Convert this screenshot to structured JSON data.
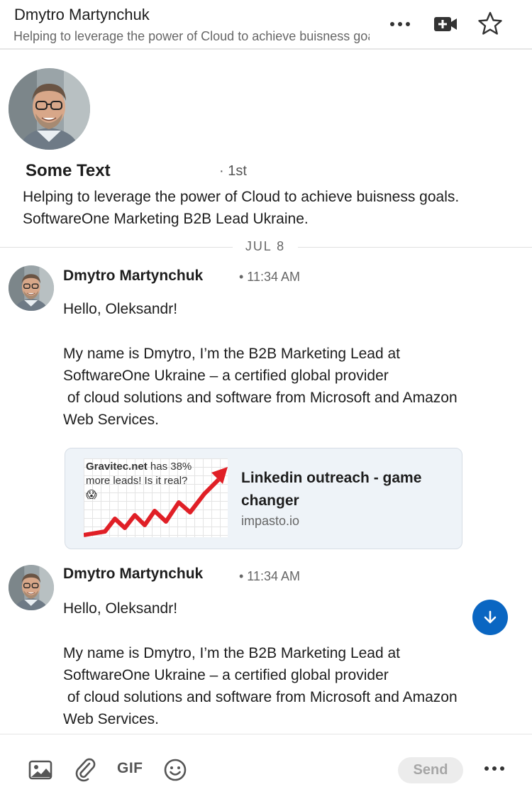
{
  "header": {
    "name": "Dmytro Martynchuk",
    "headline": "Helping to leverage the power of Cloud to achieve buisness goals. SoftwareOne Marketing B2B Lead Ukraine."
  },
  "profile": {
    "name": "Some Text",
    "degree": "· 1st",
    "headline": "Helping to leverage the power of Cloud to achieve buisness goals. SoftwareOne Marketing B2B Lead Ukraine."
  },
  "conversation": {
    "date_divider": "JUL 8",
    "messages": [
      {
        "sender": "Dmytro Martynchuk",
        "time": "• 11:34 AM",
        "body": "Hello, Oleksandr!\n\nMy name is Dmytro, I’m the B2B Marketing Lead at SoftwareOne Ukraine – a certified global provider\n of cloud solutions and software from Microsoft and Amazon Web Services."
      },
      {
        "sender": "Dmytro Martynchuk",
        "time": "• 11:34 AM",
        "body": "Hello, Oleksandr!\n\nMy name is Dmytro, I’m the B2B Marketing Lead at SoftwareOne Ukraine – a certified global provider\n of cloud solutions and software from Microsoft and Amazon Web Services."
      }
    ],
    "link_preview": {
      "thumb_brand": "Gravitec.net",
      "thumb_text": " has 38% more leads! Is it real? 😱",
      "title": "Linkedin outreach - game changer",
      "domain": "impasto.io"
    }
  },
  "toolbar": {
    "gif_label": "GIF",
    "send_label": "Send"
  },
  "colors": {
    "accent": "#0a66c2",
    "send_disabled_bg": "#ececec",
    "chart_red": "#e01f26"
  }
}
